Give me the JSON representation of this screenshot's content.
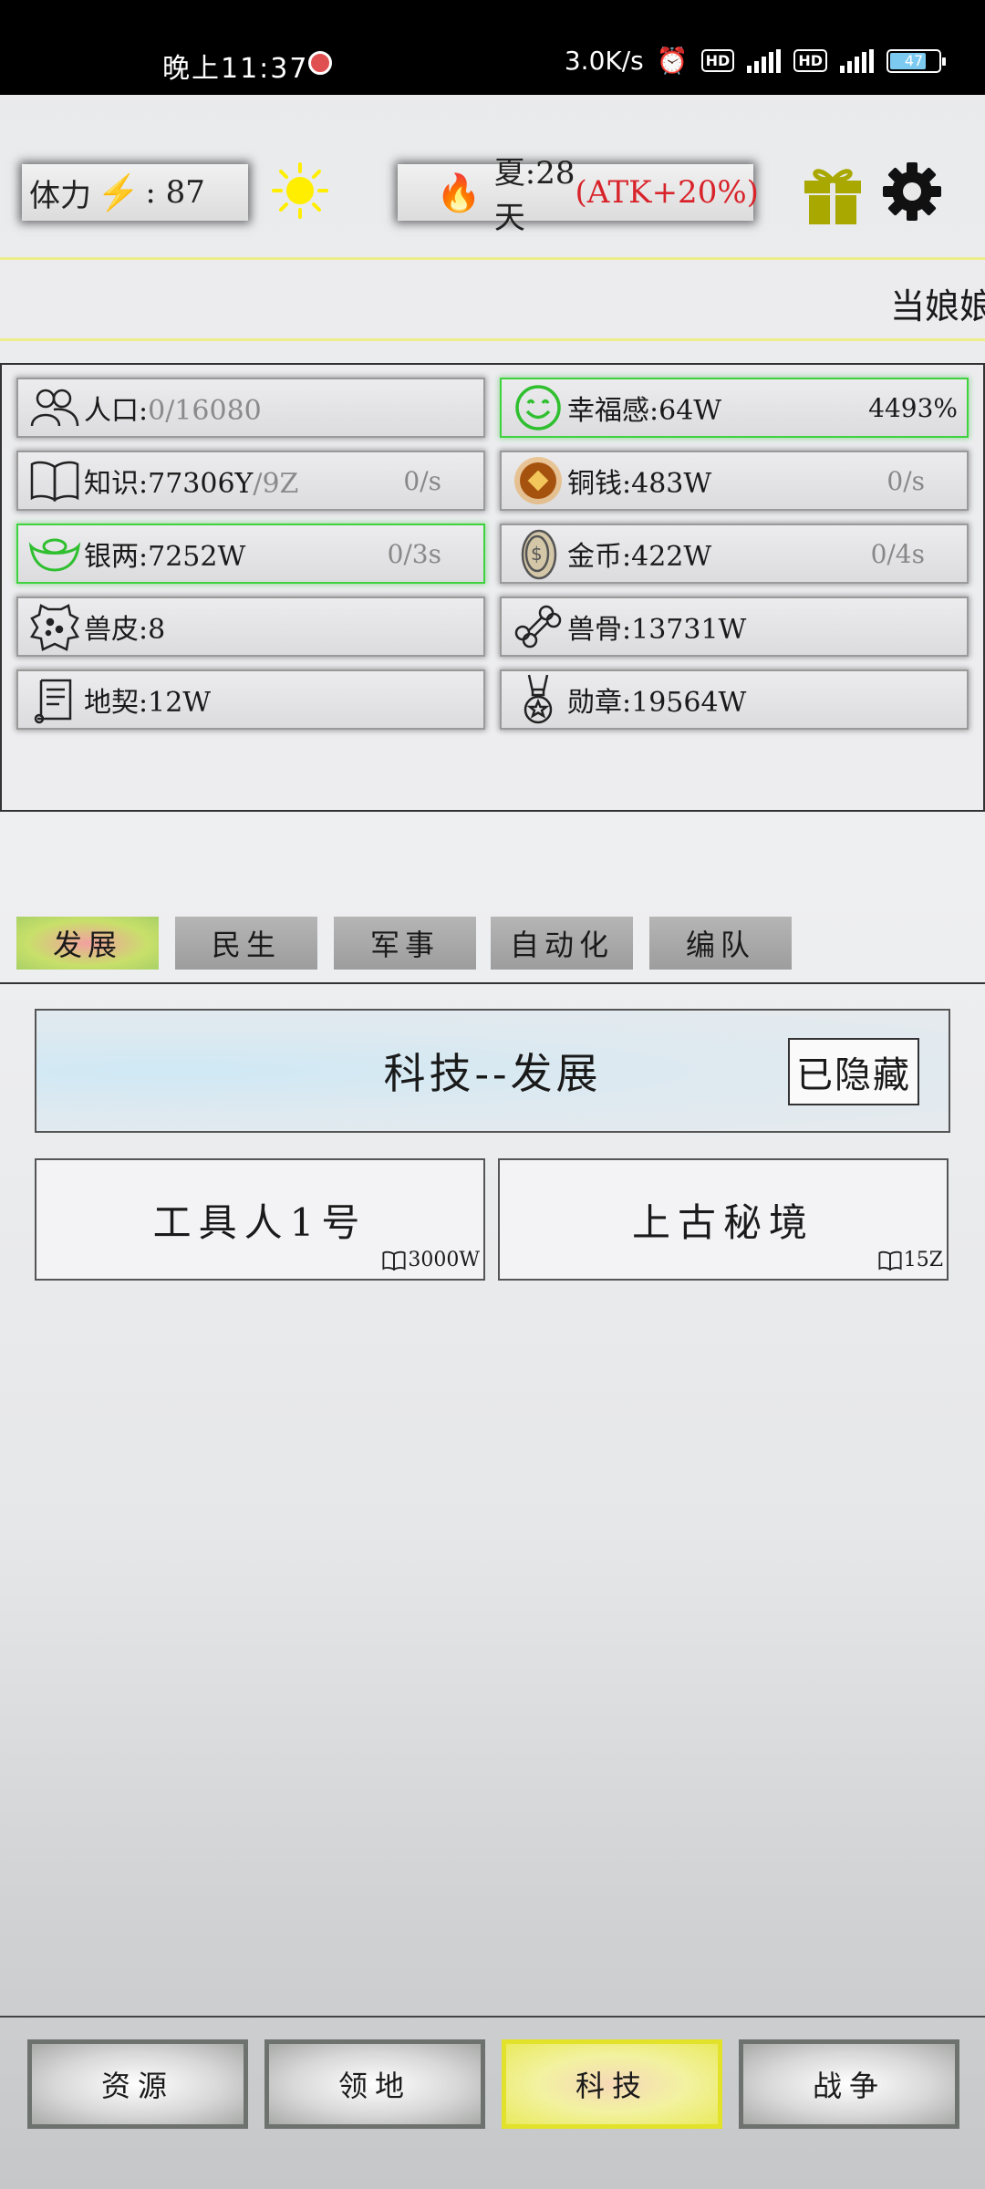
{
  "status_bar": {
    "time": "晚上11:37",
    "net_speed": "3.0K/s",
    "battery": "47"
  },
  "top": {
    "stamina_label": "体力",
    "stamina_value": ": 87",
    "season_text": "夏:28天",
    "season_bonus": "(ATK+20%)"
  },
  "marquee": {
    "text": "当娘娘"
  },
  "resources": {
    "population": {
      "label": "人口:",
      "value": "0",
      "max": "/16080"
    },
    "happiness": {
      "label": "幸福感:",
      "value": "64W",
      "pct": "4493%"
    },
    "knowledge": {
      "label": "知识:",
      "value": "77306Y",
      "max": "/9Z",
      "rate": "0/s"
    },
    "copper": {
      "label": "铜钱:",
      "value": "483W",
      "rate": "0/s"
    },
    "silver": {
      "label": "银两:",
      "value": "7252W",
      "rate": "0/3s"
    },
    "gold": {
      "label": "金币:",
      "value": "422W",
      "rate": "0/4s"
    },
    "hide": {
      "label": "兽皮:",
      "value": "8"
    },
    "bone": {
      "label": "兽骨:",
      "value": "13731W"
    },
    "deed": {
      "label": "地契:",
      "value": "12W"
    },
    "medal": {
      "label": "勋章:",
      "value": "19564W"
    }
  },
  "tabs": [
    "发展",
    "民生",
    "军事",
    "自动化",
    "编队"
  ],
  "active_tab": "发展",
  "section": {
    "title": "科技--发展",
    "hide_button": "已隐藏"
  },
  "tech_cards": [
    {
      "name": "工具人1号",
      "cost": "3000W"
    },
    {
      "name": "上古秘境",
      "cost": "15Z"
    }
  ],
  "bottom_nav": [
    "资源",
    "领地",
    "科技",
    "战争"
  ],
  "active_nav": "科技",
  "colors": {
    "accent_green": "#3fd23f",
    "atk_red": "#d8232a",
    "active_nav": "#eaea60",
    "sun": "#ffee00",
    "gift": "#a8a800"
  }
}
